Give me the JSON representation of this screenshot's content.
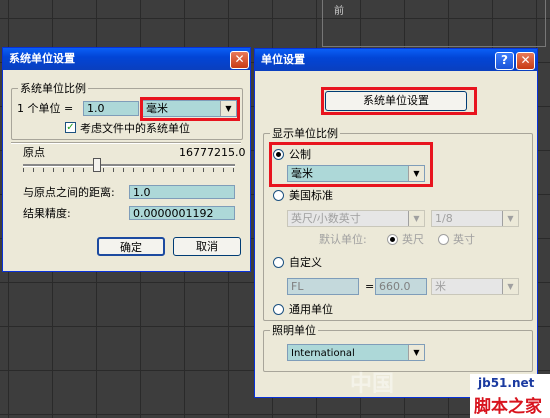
{
  "viewport": {
    "label": "前"
  },
  "dlg1": {
    "title": "系统单位设置",
    "scale_group": "系统单位比例",
    "one_unit_label": "1 个单位 =",
    "unit_value": "1.0",
    "unit_select": "毫米",
    "consider_files_label": "考虑文件中的系统单位",
    "origin_label": "原点",
    "origin_value": "16777215.0",
    "distance_label": "与原点之间的距离:",
    "distance_value": "1.0",
    "precision_label": "结果精度:",
    "precision_value": "0.0000001192",
    "ok_label": "确定",
    "cancel_label": "取消"
  },
  "dlg2": {
    "title": "单位设置",
    "help_glyph": "?",
    "system_button": "系统单位设置",
    "display_group": "显示单位比例",
    "metric_label": "公制",
    "metric_select": "毫米",
    "us_label": "美国标准",
    "us_select": "英尺/小数英寸",
    "us_fraction": "1/8",
    "default_unit_label": "默认单位:",
    "feet_label": "英尺",
    "inches_label": "英寸",
    "custom_label": "自定义",
    "custom_name": "FL",
    "custom_equals": "=",
    "custom_value": "660.0",
    "custom_unit": "米",
    "generic_label": "通用单位",
    "lighting_group": "照明单位",
    "lighting_select": "International"
  },
  "watermark": {
    "site": "jb51.net",
    "brand": "脚本之家",
    "left_text": "中国"
  }
}
